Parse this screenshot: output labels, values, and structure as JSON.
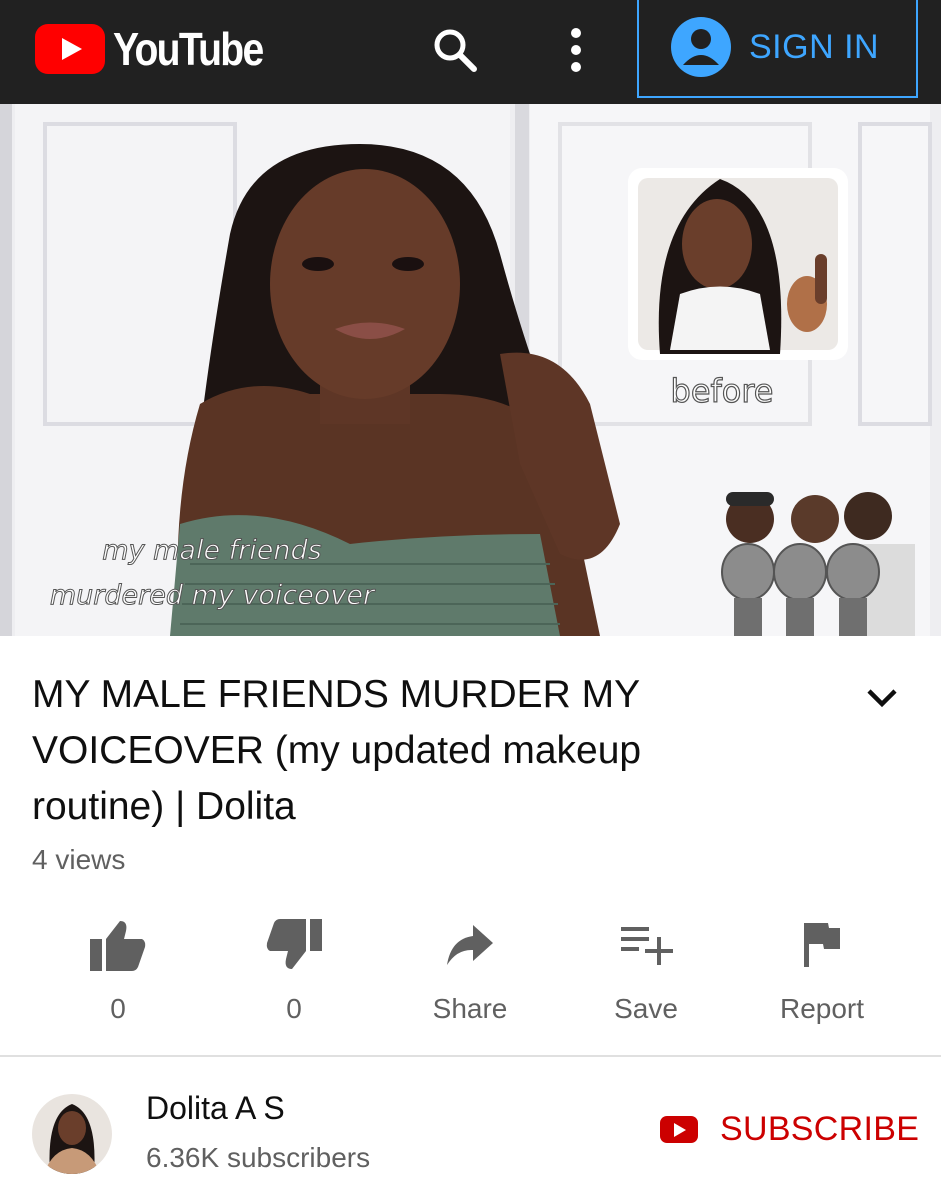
{
  "header": {
    "brand": "YouTube",
    "sign_in_label": "SIGN IN"
  },
  "video": {
    "overlay_caption_line1": "my male friends",
    "overlay_caption_line2": "murdered my voiceover",
    "inset_caption": "before"
  },
  "info": {
    "title": "MY MALE FRIENDS MURDER MY VOICEOVER (my updated makeup routine) | Dolita",
    "views": "4 views"
  },
  "actions": [
    {
      "icon": "thumbs-up-icon",
      "label": "0"
    },
    {
      "icon": "thumbs-down-icon",
      "label": "0"
    },
    {
      "icon": "share-icon",
      "label": "Share"
    },
    {
      "icon": "playlist-add-icon",
      "label": "Save"
    },
    {
      "icon": "flag-icon",
      "label": "Report"
    }
  ],
  "channel": {
    "name": "Dolita A S",
    "subscribers": "6.36K subscribers",
    "subscribe_label": "SUBSCRIBE"
  },
  "colors": {
    "topbar": "#212121",
    "accent_blue": "#3ea6ff",
    "youtube_red": "#ff0000",
    "subscribe_red": "#cc0000"
  }
}
